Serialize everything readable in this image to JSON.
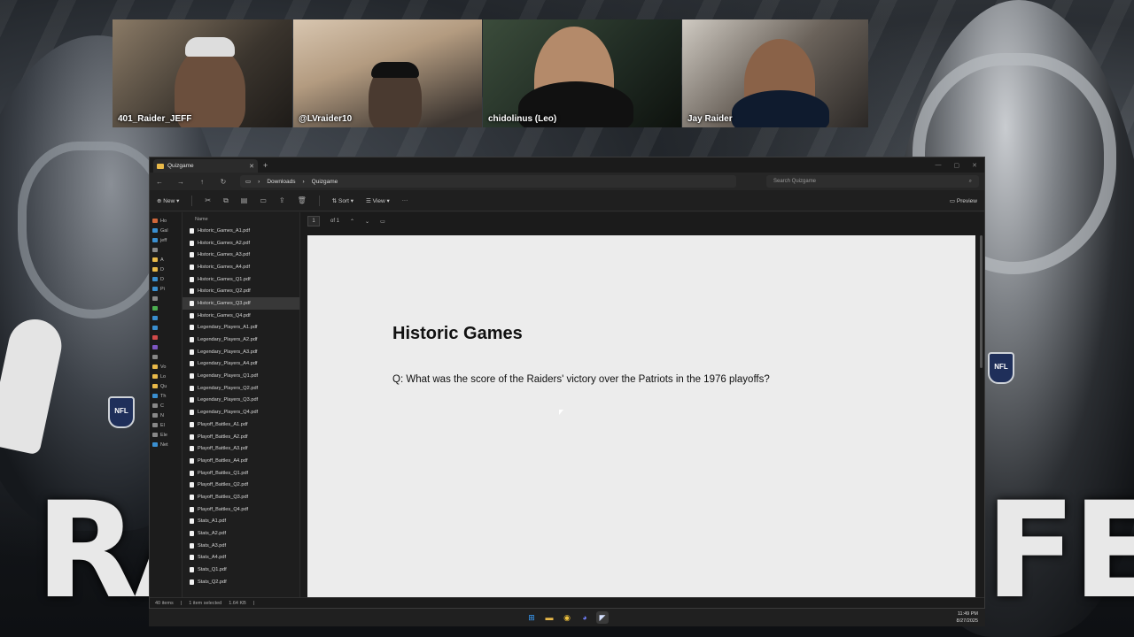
{
  "background": {
    "left_text": "RA",
    "right_text": "FE",
    "nfl_badge": "NFL"
  },
  "webcams": [
    {
      "name": "401_Raider_JEFF"
    },
    {
      "name": "@LVraider10"
    },
    {
      "name": "chidolinus (Leo)"
    },
    {
      "name": "Jay Raider"
    }
  ],
  "explorer": {
    "tab_title": "Quizgame",
    "breadcrumbs": [
      "Downloads",
      "Quizgame"
    ],
    "search_placeholder": "Search Quizgame",
    "toolbar": {
      "new_label": "New",
      "sort_label": "Sort",
      "view_label": "View",
      "more_label": "···",
      "preview_label": "Preview"
    },
    "column_header": "Name",
    "nav_items": [
      "Ho",
      "Gal",
      "jeff",
      "",
      "A",
      "D",
      "D",
      "Pi",
      "",
      "",
      "",
      "",
      "",
      "",
      "",
      "Vo",
      "Lo",
      "Qu",
      "Th",
      "C",
      "N",
      "El",
      "Ele",
      "Net"
    ],
    "files": [
      "Historic_Games_A1.pdf",
      "Historic_Games_A2.pdf",
      "Historic_Games_A3.pdf",
      "Historic_Games_A4.pdf",
      "Historic_Games_Q1.pdf",
      "Historic_Games_Q2.pdf",
      "Historic_Games_Q3.pdf",
      "Historic_Games_Q4.pdf",
      "Legendary_Players_A1.pdf",
      "Legendary_Players_A2.pdf",
      "Legendary_Players_A3.pdf",
      "Legendary_Players_A4.pdf",
      "Legendary_Players_Q1.pdf",
      "Legendary_Players_Q2.pdf",
      "Legendary_Players_Q3.pdf",
      "Legendary_Players_Q4.pdf",
      "Playoff_Battles_A1.pdf",
      "Playoff_Battles_A2.pdf",
      "Playoff_Battles_A3.pdf",
      "Playoff_Battles_A4.pdf",
      "Playoff_Battles_Q1.pdf",
      "Playoff_Battles_Q2.pdf",
      "Playoff_Battles_Q3.pdf",
      "Playoff_Battles_Q4.pdf",
      "Stats_A1.pdf",
      "Stats_A2.pdf",
      "Stats_A3.pdf",
      "Stats_A4.pdf",
      "Stats_Q1.pdf",
      "Stats_Q2.pdf"
    ],
    "selected_file": "Historic_Games_Q3.pdf",
    "viewer": {
      "page_number": "1",
      "page_total": "of 1"
    },
    "document": {
      "title": "Historic Games",
      "question": "Q: What was the score of the Raiders' victory over the Patriots in the 1976 playoffs?"
    },
    "status": {
      "item_count": "40 items",
      "selection": "1 item selected",
      "size": "1.64 KB"
    }
  },
  "taskbar": {
    "time": "11:49 PM",
    "date": "8/27/2025"
  }
}
